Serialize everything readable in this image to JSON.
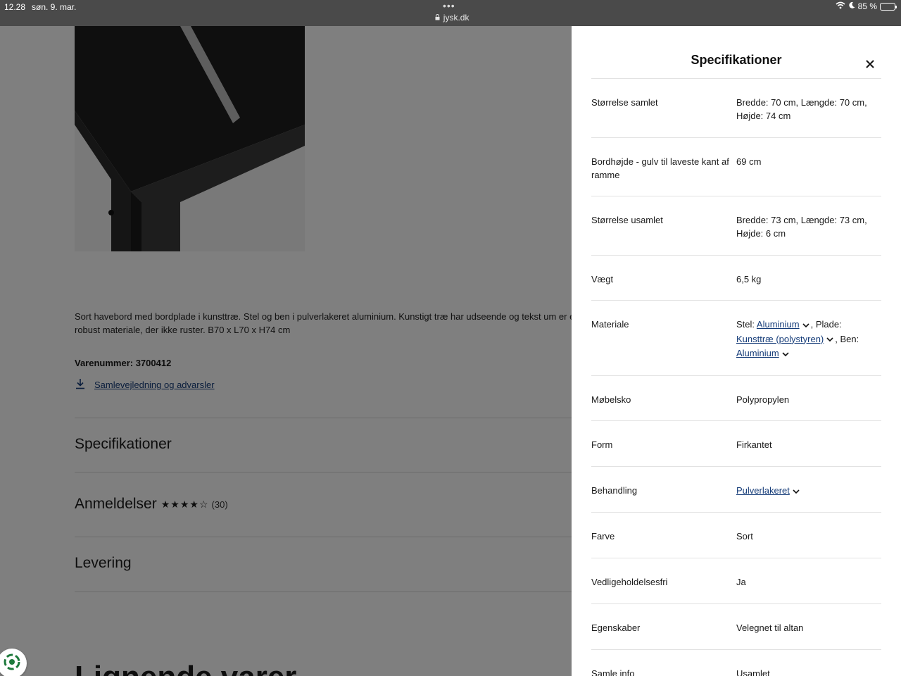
{
  "status_bar": {
    "time": "12.28",
    "date": "søn. 9. mar.",
    "url": "jysk.dk",
    "battery": "85 %",
    "battery_level": 0.85
  },
  "product": {
    "description": "Sort havebord med bordplade i kunsttræ. Stel og ben i pulverlakeret aluminium. Kunstigt træ har udseende og tekst um er et let og robust materiale, der ikke ruster. B70 x L70 x H74 cm",
    "item_number": "Varenummer: 3700412",
    "download_link": "Samlevejledning og advarsler"
  },
  "accordion": {
    "specs": "Specifikationer",
    "reviews": "Anmeldelser",
    "reviews_rating": 4,
    "reviews_max": 5,
    "reviews_count": "(30)",
    "delivery": "Levering"
  },
  "bottom_heading": "Lignende varer",
  "panel": {
    "title": "Specifikationer",
    "rows": [
      {
        "label": "Størrelse samlet",
        "value": "Bredde: 70 cm, Længde: 70 cm, Højde: 74 cm"
      },
      {
        "label": "Bordhøjde - gulv til laveste kant af ramme",
        "value": "69 cm"
      },
      {
        "label": "Størrelse usamlet",
        "value": "Bredde: 73 cm, Længde: 73 cm, Højde: 6 cm"
      },
      {
        "label": "Vægt",
        "value": "6,5 kg"
      },
      {
        "label": "Materiale",
        "prefix1": "Stel:",
        "link1": "Aluminium",
        "prefix2": ", Plade:",
        "link2": "Kunsttræ (polystyren)",
        "prefix3": ", Ben:",
        "link3": "Aluminium"
      },
      {
        "label": "Møbelsko",
        "value": "Polypropylen"
      },
      {
        "label": "Form",
        "value": "Firkantet"
      },
      {
        "label": "Behandling",
        "link1": "Pulverlakeret"
      },
      {
        "label": "Farve",
        "value": "Sort"
      },
      {
        "label": "Vedligeholdelsesfri",
        "value": "Ja"
      },
      {
        "label": "Egenskaber",
        "value": "Velegnet til altan"
      },
      {
        "label": "Samle info",
        "value": "Usamlet"
      }
    ]
  }
}
